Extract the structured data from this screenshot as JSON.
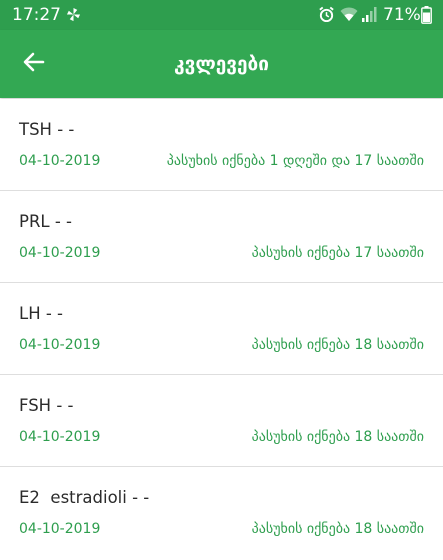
{
  "status_bar": {
    "time": "17:27",
    "battery_percent": "71%",
    "icons": [
      "pinwheel-icon",
      "alarm-icon",
      "wifi-icon",
      "signal-icon",
      "battery-icon"
    ],
    "background_color": "#2e9e4e"
  },
  "app_bar": {
    "title": "კვლევები",
    "back_icon": "arrow-left-icon",
    "background_color": "#33a853"
  },
  "results": [
    {
      "name": "TSH - -",
      "date": "04-10-2019",
      "eta": "პასუხის იქნება 1 დღეში და 17 საათში"
    },
    {
      "name": "PRL - -",
      "date": "04-10-2019",
      "eta": "პასუხის იქნება 17 საათში"
    },
    {
      "name": "LH - -",
      "date": "04-10-2019",
      "eta": "პასუხის იქნება 18 საათში"
    },
    {
      "name": "FSH - -",
      "date": "04-10-2019",
      "eta": "პასუხის იქნება 18 საათში"
    },
    {
      "name": "E2  estradioli - -",
      "date": "04-10-2019",
      "eta": "პასუხის იქნება 18 საათში"
    }
  ],
  "colors": {
    "accent_green": "#2e9e4e",
    "title_text": "#2b2b2b",
    "divider": "#dedede"
  }
}
